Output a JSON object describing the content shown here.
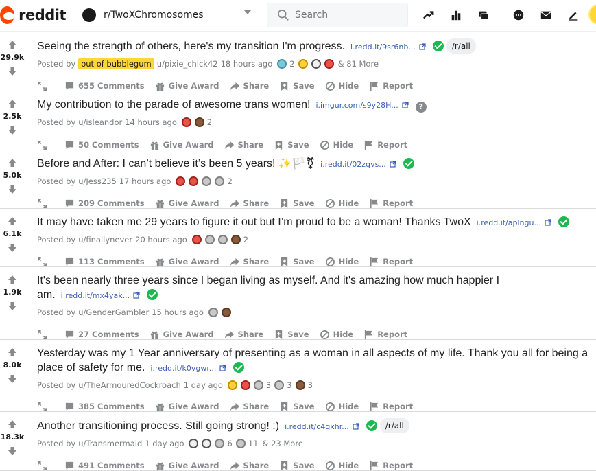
{
  "header": {
    "logo_text": "reddit",
    "community": "r/TwoXChromosomes",
    "search_placeholder": "Search",
    "icons": [
      "popular-icon",
      "stats-icon",
      "coins-icon",
      "chat-icon",
      "mail-icon",
      "create-post-icon",
      "avatar"
    ]
  },
  "actions": {
    "give_award": "Give Award",
    "share": "Share",
    "save": "Save",
    "hide": "Hide",
    "report": "Report"
  },
  "colors": {
    "accent": "#ff4500",
    "verified": "#1db850",
    "link": "#3d5fb3",
    "flair_yellow": "#ffd635"
  },
  "posts": [
    {
      "score": "29.9k",
      "title": "Seeing the strength of others, here's my transition I'm progress.",
      "link": "i.redd.it/9sr6nb...",
      "status": "check",
      "flair_tag": "/r/all",
      "posted_by": "Posted by",
      "user_flair": "out of bubblegum",
      "author": "u/pixie_chick42",
      "time": "18 hours ago",
      "awards": [
        {
          "type": "a-b",
          "count": "2"
        },
        {
          "type": "a-y"
        },
        {
          "type": "a-w"
        },
        {
          "type": "a-h"
        }
      ],
      "more": "& 81 More",
      "comments": "655 Comments"
    },
    {
      "score": "2.5k",
      "title": "My contribution to the parade of awesome trans women!",
      "link": "i.imgur.com/s9y28H...",
      "status": "question",
      "posted_by": "Posted by",
      "author": "u/isleandor",
      "time": "14 hours ago",
      "awards": [
        {
          "type": "a-h"
        },
        {
          "type": "a-p",
          "count": "2"
        }
      ],
      "comments": "50 Comments"
    },
    {
      "score": "5.0k",
      "title": "Before and After: I can’t believe it’s been 5 years! ✨🏳️⚧",
      "link": "i.redd.it/02zgvs...",
      "status": "check",
      "posted_by": "Posted by",
      "author": "u/Jess235",
      "time": "17 hours ago",
      "awards": [
        {
          "type": "a-h"
        },
        {
          "type": "a-h"
        },
        {
          "type": "a-g"
        },
        {
          "type": "a-g",
          "count": "2"
        }
      ],
      "comments": "209 Comments"
    },
    {
      "score": "6.1k",
      "title": "It may have taken me 29 years to figure it out but I’m proud to be a woman! Thanks TwoX",
      "link": "i.redd.it/aplngu...",
      "status": "check",
      "posted_by": "Posted by",
      "author": "u/finallynever",
      "time": "20 hours ago",
      "awards": [
        {
          "type": "a-h"
        },
        {
          "type": "a-g"
        },
        {
          "type": "a-g"
        },
        {
          "type": "a-p",
          "count": "2"
        }
      ],
      "comments": "113 Comments"
    },
    {
      "score": "1.9k",
      "title": "It's been nearly three years since I began living as myself. And it's amazing how much happier I am.",
      "link": "i.redd.it/mx4yak...",
      "status": "check",
      "posted_by": "Posted by",
      "author": "u/GenderGambler",
      "time": "15 hours ago",
      "awards": [
        {
          "type": "a-g"
        },
        {
          "type": "a-p"
        }
      ],
      "comments": "27 Comments"
    },
    {
      "score": "8.0k",
      "title": "Yesterday was my 1 Year anniversary of presenting as a woman in all aspects of my life. Thank you all for being a place of safety for me.",
      "link": "i.redd.it/k0vgwr...",
      "status": "check",
      "posted_by": "Posted by",
      "author": "u/TheArmouredCockroach",
      "time": "1 day ago",
      "awards": [
        {
          "type": "a-y"
        },
        {
          "type": "a-h"
        },
        {
          "type": "a-g",
          "count": "3"
        },
        {
          "type": "a-g",
          "count": "3"
        },
        {
          "type": "a-p",
          "count": "3"
        }
      ],
      "comments": "385 Comments"
    },
    {
      "score": "18.3k",
      "title": "Another transitioning process. Still going strong! :)",
      "link": "i.redd.it/c4qxhr...",
      "status": "check",
      "flair_tag": "/r/all",
      "posted_by": "Posted by",
      "author": "u/Transmermaid",
      "time": "1 day ago",
      "awards": [
        {
          "type": "a-w"
        },
        {
          "type": "a-w"
        },
        {
          "type": "a-g",
          "count": "6"
        },
        {
          "type": "a-g",
          "count": "11"
        }
      ],
      "more": "& 23 More",
      "comments": "491 Comments"
    }
  ]
}
